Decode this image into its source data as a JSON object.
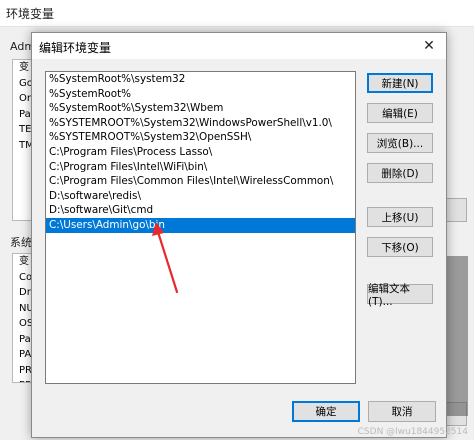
{
  "background_window": {
    "title": "环境变量",
    "user_section_label": "Adm",
    "user_list": [
      "变",
      "Go",
      "On",
      "Pa",
      "TE",
      "TM"
    ],
    "system_section_label": "系统",
    "system_list": [
      "变",
      "Co",
      "Dri",
      "NU",
      "OS",
      "Pa",
      "PA",
      "PR",
      "PR"
    ]
  },
  "dialog": {
    "title": "编辑环境变量",
    "close_glyph": "✕",
    "paths": [
      "%SystemRoot%\\system32",
      "%SystemRoot%",
      "%SystemRoot%\\System32\\Wbem",
      "%SYSTEMROOT%\\System32\\WindowsPowerShell\\v1.0\\",
      "%SYSTEMROOT%\\System32\\OpenSSH\\",
      "C:\\Program Files\\Process Lasso\\",
      "C:\\Program Files\\Intel\\WiFi\\bin\\",
      "C:\\Program Files\\Common Files\\Intel\\WirelessCommon\\",
      "D:\\software\\redis\\",
      "D:\\software\\Git\\cmd",
      "C:\\Users\\Admin\\go\\bin"
    ],
    "selected_index": 10,
    "buttons": {
      "new": "新建(N)",
      "edit": "编辑(E)",
      "browse": "浏览(B)...",
      "delete": "删除(D)",
      "move_up": "上移(U)",
      "move_down": "下移(O)",
      "edit_text": "编辑文本(T)...",
      "ok": "确定",
      "cancel": "取消"
    }
  },
  "watermark": "CSDN @lwu1844952514",
  "colors": {
    "selection": "#0078d7",
    "annotation_arrow": "#e8282c"
  }
}
